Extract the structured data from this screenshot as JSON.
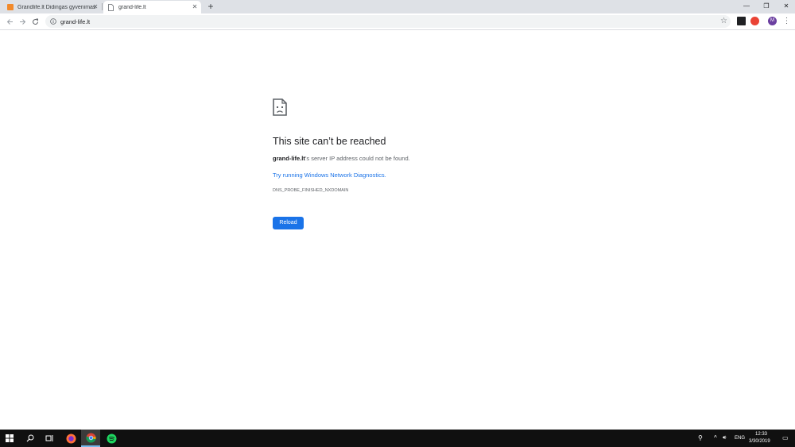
{
  "browser": {
    "tabs": [
      {
        "title": "Grandlife.lt Didingas gyvenimas",
        "active": false,
        "favicon": "grandlife-favicon"
      },
      {
        "title": "grand-life.lt",
        "active": true,
        "favicon": "document-icon"
      }
    ],
    "address": "grand-life.lt",
    "profile_initial": "M"
  },
  "error_page": {
    "title": "This site can’t be reached",
    "host": "grand-life.lt",
    "message": "’s server IP address could not be found.",
    "link": "Try running Windows Network Diagnostics.",
    "code": "DNS_PROBE_FINISHED_NXDOMAIN",
    "reload_label": "Reload"
  },
  "taskbar": {
    "language": "ENG",
    "time": "12:33",
    "date": "3/30/2019"
  },
  "colors": {
    "accent": "#1a73e8",
    "tabstrip": "#dee1e6",
    "taskbar": "#101010"
  }
}
